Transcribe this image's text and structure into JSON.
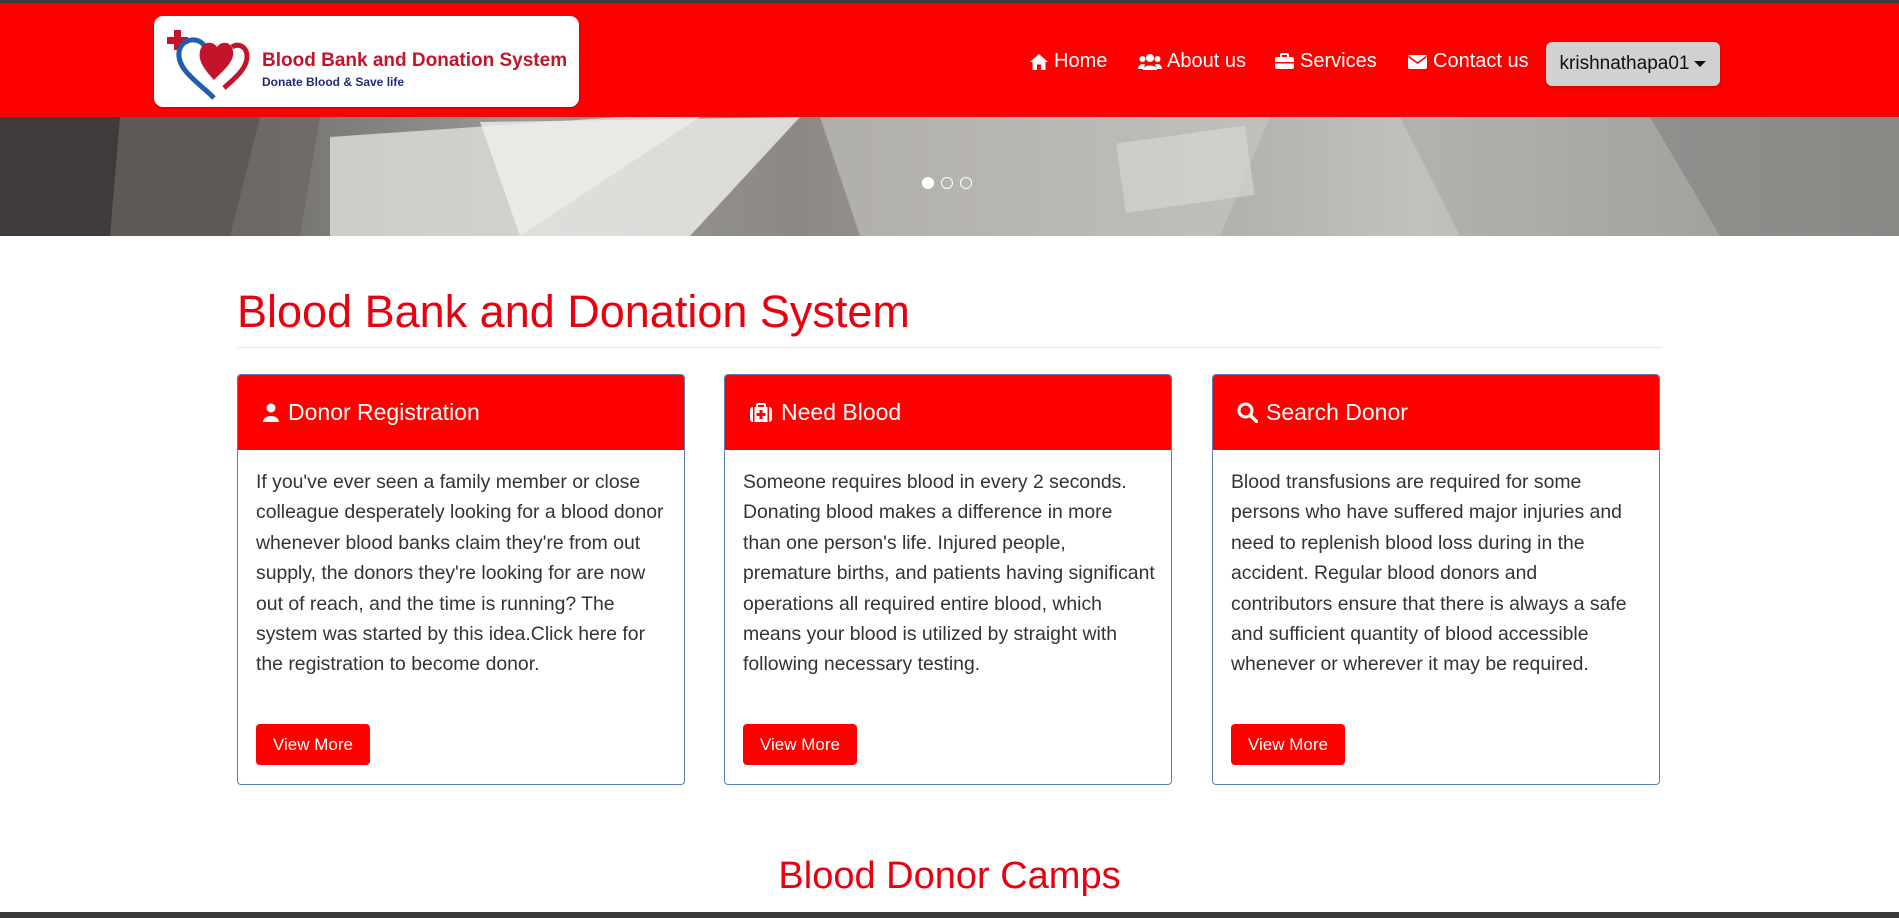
{
  "brand": {
    "title": "Blood Bank and Donation System",
    "tagline": "Donate Blood & Save life"
  },
  "nav": {
    "items": [
      {
        "label": "Home",
        "icon": "home-icon"
      },
      {
        "label": "About us",
        "icon": "users-icon"
      },
      {
        "label": "Services",
        "icon": "briefcase-icon"
      },
      {
        "label": "Contact us",
        "icon": "envelope-icon"
      }
    ],
    "user": "krishnathapa01"
  },
  "carousel": {
    "slides": 3,
    "active_slide": 1
  },
  "main": {
    "title": "Blood Bank and Donation System",
    "cards": [
      {
        "title": "Donor Registration",
        "icon": "user-icon",
        "text": "If you've ever seen a family member or close colleague desperately looking for a blood donor whenever blood banks claim they're from out supply, the donors they're looking for are now out of reach, and the time is running? The system was started by this idea.Click here for the registration to become donor.",
        "button": "View More"
      },
      {
        "title": "Need Blood",
        "icon": "medkit-icon",
        "text": "Someone requires blood in every 2 seconds. Donating blood makes a difference in more than one person's life. Injured people, premature births, and patients having significant operations all required entire blood, which means your blood is utilized by straight with following necessary testing.",
        "button": "View More"
      },
      {
        "title": "Search Donor",
        "icon": "search-icon",
        "text": "Blood transfusions are required for some persons who have suffered major injuries and need to replenish blood loss during in the accident. Regular blood donors and contributors ensure that there is always a safe and sufficient quantity of blood accessible whenever or wherever it may be required.",
        "button": "View More"
      }
    ],
    "section2_title": "Blood Donor Camps"
  },
  "colors": {
    "primary": "#ff0000",
    "heading": "#e8000e",
    "card_border": "#5a7fb2",
    "user_button": "#d1d1d1"
  }
}
